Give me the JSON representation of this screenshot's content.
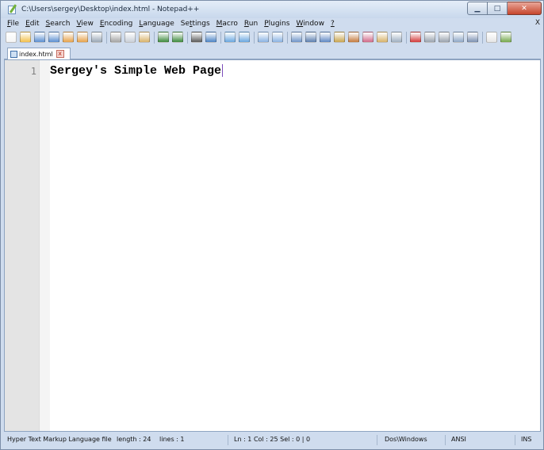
{
  "window": {
    "title": "C:\\Users\\sergey\\Desktop\\index.html - Notepad++"
  },
  "menu": {
    "items": [
      {
        "u": "F",
        "rest": "ile"
      },
      {
        "u": "E",
        "rest": "dit"
      },
      {
        "u": "S",
        "rest": "earch"
      },
      {
        "u": "V",
        "rest": "iew"
      },
      {
        "u": "E",
        "rest": "ncoding"
      },
      {
        "u": "L",
        "rest": "anguage"
      },
      {
        "pre": "Se",
        "u": "t",
        "rest": "tings"
      },
      {
        "u": "M",
        "rest": "acro"
      },
      {
        "u": "R",
        "rest": "un"
      },
      {
        "u": "P",
        "rest": "lugins"
      },
      {
        "u": "W",
        "rest": "indow"
      },
      {
        "u": "?",
        "rest": ""
      }
    ],
    "close_label": "X"
  },
  "toolbar": {
    "buttons": [
      {
        "name": "new-file-icon",
        "color": "#f5f5f5"
      },
      {
        "name": "open-file-icon",
        "color": "#f3c14c"
      },
      {
        "name": "save-icon",
        "color": "#5b8fd1"
      },
      {
        "name": "save-all-icon",
        "color": "#5b8fd1"
      },
      {
        "name": "close-icon",
        "color": "#e7a24a"
      },
      {
        "name": "close-all-icon",
        "color": "#e7a24a"
      },
      {
        "name": "print-icon",
        "color": "#9aa7b6"
      },
      {
        "sep": true
      },
      {
        "name": "cut-icon",
        "color": "#a4a4a4"
      },
      {
        "name": "copy-icon",
        "color": "#c9cfd8"
      },
      {
        "name": "paste-icon",
        "color": "#d9b36a"
      },
      {
        "sep": true
      },
      {
        "name": "undo-icon",
        "color": "#3c8a3c"
      },
      {
        "name": "redo-icon",
        "color": "#3c8a3c"
      },
      {
        "sep": true
      },
      {
        "name": "find-icon",
        "color": "#5a5a5a"
      },
      {
        "name": "replace-icon",
        "color": "#4c84c6"
      },
      {
        "sep": true
      },
      {
        "name": "zoom-in-icon",
        "color": "#6aa7e0"
      },
      {
        "name": "zoom-out-icon",
        "color": "#6aa7e0"
      },
      {
        "sep": true
      },
      {
        "name": "sync-vertical-icon",
        "color": "#8bb3e3"
      },
      {
        "name": "sync-horizontal-icon",
        "color": "#8bb3e3"
      },
      {
        "sep": true
      },
      {
        "name": "word-wrap-icon",
        "color": "#6f95c9"
      },
      {
        "name": "show-all-chars-icon",
        "color": "#5c7fb0"
      },
      {
        "name": "indent-guide-icon",
        "color": "#5f88c4"
      },
      {
        "name": "doc-map-icon",
        "color": "#c9a54f"
      },
      {
        "name": "function-list-icon",
        "color": "#c57a3e"
      },
      {
        "name": "user-defined-lang-icon",
        "color": "#d06a8a"
      },
      {
        "name": "folder-workspace-icon",
        "color": "#d7b36a"
      },
      {
        "name": "monitoring-icon",
        "color": "#9fb0c2"
      },
      {
        "sep": true
      },
      {
        "name": "record-macro-icon",
        "color": "#d33a3a"
      },
      {
        "name": "stop-record-icon",
        "color": "#9aa3ae"
      },
      {
        "name": "playback-icon",
        "color": "#9aa3ae"
      },
      {
        "name": "run-macro-multiple-icon",
        "color": "#8ea7c7"
      },
      {
        "name": "save-macro-icon",
        "color": "#7b91b2"
      },
      {
        "sep": true
      },
      {
        "name": "spell-check-icon",
        "color": "#e6e6e6"
      },
      {
        "name": "plugin-icon",
        "color": "#74a84a"
      }
    ]
  },
  "tab": {
    "label": "index.html",
    "close_glyph": "x"
  },
  "editor": {
    "line_number": "1",
    "code": "Sergey's Simple Web Page"
  },
  "status": {
    "language": "Hyper Text Markup Language file",
    "length": "length : 24",
    "lines": "lines : 1",
    "position": "Ln : 1    Col : 25    Sel : 0 | 0",
    "eol": "Dos\\Windows",
    "encoding": "ANSI",
    "mode": "INS"
  }
}
